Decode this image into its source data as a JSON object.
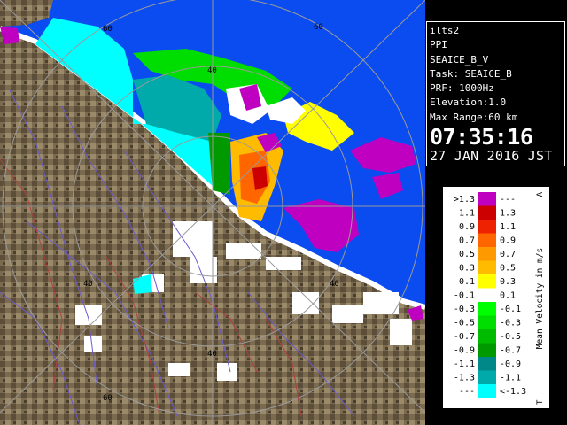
{
  "info": {
    "site": "ilts2",
    "mode": "PPI",
    "product": "SEAICE_B_V",
    "task": "Task: SEAICE_B",
    "prf": "PRF: 1000Hz",
    "elevation": "Elevation:1.0",
    "max_range": "Max Range:60 km",
    "time": "07:35:16",
    "date": "27 JAN 2016 JST"
  },
  "legend": {
    "title": "Mean Velocity in m/s",
    "top_marker": "A",
    "bottom_marker": "T",
    "rows": [
      {
        "left": ">1.3",
        "right": "---",
        "color": "#c000c0"
      },
      {
        "left": "1.1",
        "right": "1.3",
        "color": "#cc0000"
      },
      {
        "left": "0.9",
        "right": "1.1",
        "color": "#ee2200"
      },
      {
        "left": "0.7",
        "right": "0.9",
        "color": "#ff6600"
      },
      {
        "left": "0.5",
        "right": "0.7",
        "color": "#ff9900"
      },
      {
        "left": "0.3",
        "right": "0.5",
        "color": "#ffbb00"
      },
      {
        "left": "0.1",
        "right": "0.3",
        "color": "#ffff00"
      },
      {
        "left": "-0.1",
        "right": "0.1",
        "color": "#ffffff"
      },
      {
        "left": "-0.3",
        "right": "-0.1",
        "color": "#00ff00"
      },
      {
        "left": "-0.5",
        "right": "-0.3",
        "color": "#00dd00"
      },
      {
        "left": "-0.7",
        "right": "-0.5",
        "color": "#00bb00"
      },
      {
        "left": "-0.9",
        "right": "-0.7",
        "color": "#009900"
      },
      {
        "left": "-1.1",
        "right": "-0.9",
        "color": "#008888"
      },
      {
        "left": "-1.3",
        "right": "-1.1",
        "color": "#00aaaa"
      },
      {
        "left": "---",
        "right": "<-1.3",
        "color": "#00ffff"
      }
    ]
  },
  "map": {
    "ring_labels": [
      "60",
      "60",
      "40",
      "40",
      "40",
      "40",
      "60"
    ],
    "colors": {
      "sea": "#0a4cf0",
      "land": "#7a6a50",
      "ring": "#9a9a9a",
      "coast": "#ffffff"
    }
  }
}
